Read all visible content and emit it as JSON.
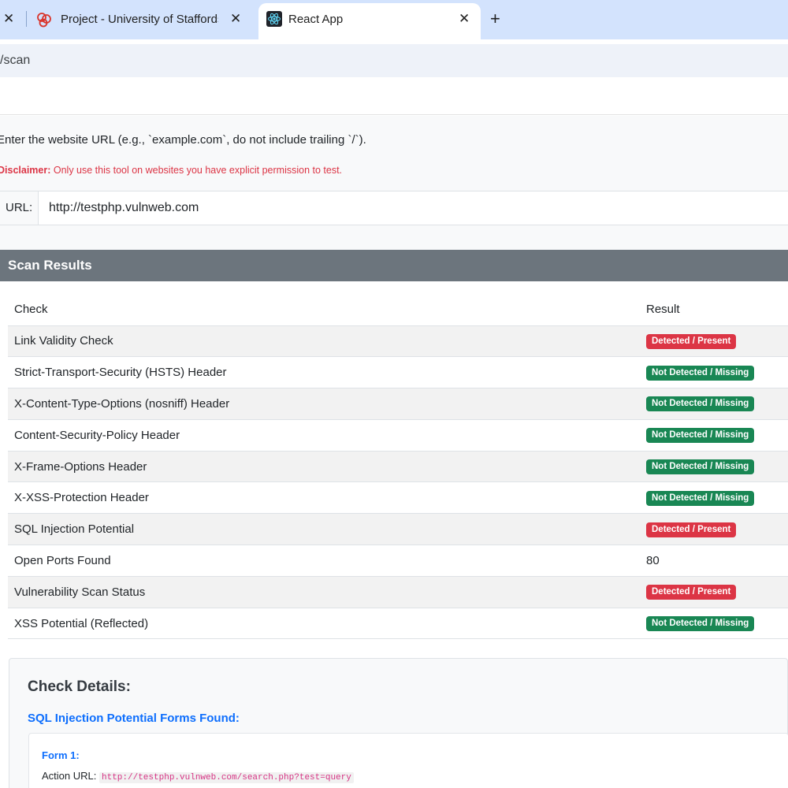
{
  "browser": {
    "tabs": [
      {
        "title": "Project - University of Staffordshire",
        "favicon": "university-logo-icon",
        "close": "✕"
      },
      {
        "title": "React App",
        "favicon": "react-logo-icon",
        "close": "✕"
      }
    ],
    "prev_tab_close": "✕",
    "new_tab": "+",
    "address": "/scan"
  },
  "page": {
    "instructions": "Enter the website URL (e.g., `example.com`, do not include trailing `/`).",
    "disclaimer_label": "Disclaimer:",
    "disclaimer_text": " Only use this tool on websites you have explicit permission to test.",
    "url_label": "URL:",
    "url_value": "http://testphp.vulnweb.com"
  },
  "results": {
    "header": "Scan Results",
    "columns": [
      "Check",
      "Result"
    ],
    "rows": [
      {
        "check": "Link Validity Check",
        "result": "Detected / Present",
        "status": "danger"
      },
      {
        "check": "Strict-Transport-Security (HSTS) Header",
        "result": "Not Detected / Missing",
        "status": "success"
      },
      {
        "check": "X-Content-Type-Options (nosniff) Header",
        "result": "Not Detected / Missing",
        "status": "success"
      },
      {
        "check": "Content-Security-Policy Header",
        "result": "Not Detected / Missing",
        "status": "success"
      },
      {
        "check": "X-Frame-Options Header",
        "result": "Not Detected / Missing",
        "status": "success"
      },
      {
        "check": "X-XSS-Protection Header",
        "result": "Not Detected / Missing",
        "status": "success"
      },
      {
        "check": "SQL Injection Potential",
        "result": "Detected / Present",
        "status": "danger"
      },
      {
        "check": "Open Ports Found",
        "result": "80",
        "status": "text"
      },
      {
        "check": "Vulnerability Scan Status",
        "result": "Detected / Present",
        "status": "danger"
      },
      {
        "check": "XSS Potential (Reflected)",
        "result": "Not Detected / Missing",
        "status": "success"
      }
    ]
  },
  "details": {
    "title": "Check Details:",
    "subtitle": "SQL Injection Potential Forms Found:",
    "form_title": "Form 1:",
    "action_label": "Action URL:",
    "action_url": "http://testphp.vulnweb.com/search.php?test=query"
  },
  "colors": {
    "danger": "#dc3545",
    "success": "#198754",
    "card_header": "#6c757d",
    "link": "#0d6efd"
  }
}
